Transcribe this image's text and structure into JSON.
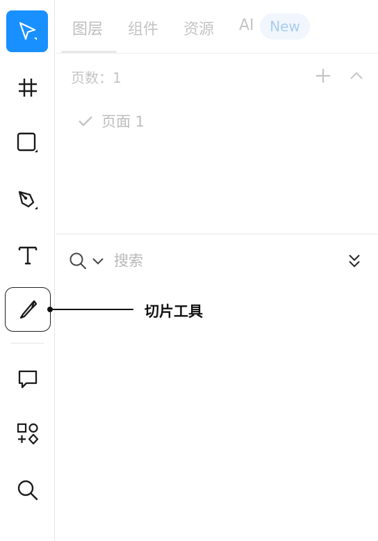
{
  "toolbar": {
    "tools": [
      {
        "name": "move-tool",
        "icon": "cursor-arrow-icon",
        "active": true
      },
      {
        "name": "frame-tool",
        "icon": "hash-frame-icon"
      },
      {
        "name": "shape-tool",
        "icon": "rectangle-icon"
      },
      {
        "name": "pen-tool",
        "icon": "pen-nib-icon"
      },
      {
        "name": "text-tool",
        "icon": "text-T-icon"
      },
      {
        "name": "slice-tool",
        "icon": "slice-knife-icon",
        "highlighted": true
      },
      {
        "name": "comment-tool",
        "icon": "comment-bubble-icon"
      },
      {
        "name": "plugins-tool",
        "icon": "shapes-grid-icon"
      },
      {
        "name": "search-tool",
        "icon": "magnifier-icon"
      }
    ],
    "accent_color": "#1890ff"
  },
  "tabs": [
    {
      "label": "图层",
      "active": true
    },
    {
      "label": "组件"
    },
    {
      "label": "资源"
    },
    {
      "label": "AI"
    }
  ],
  "ai_badge": "New",
  "pages": {
    "header": "页数：1",
    "items": [
      {
        "label": "页面 1",
        "current": true
      }
    ]
  },
  "search": {
    "placeholder": "搜索",
    "value": ""
  },
  "callout": {
    "label": "切片工具"
  }
}
